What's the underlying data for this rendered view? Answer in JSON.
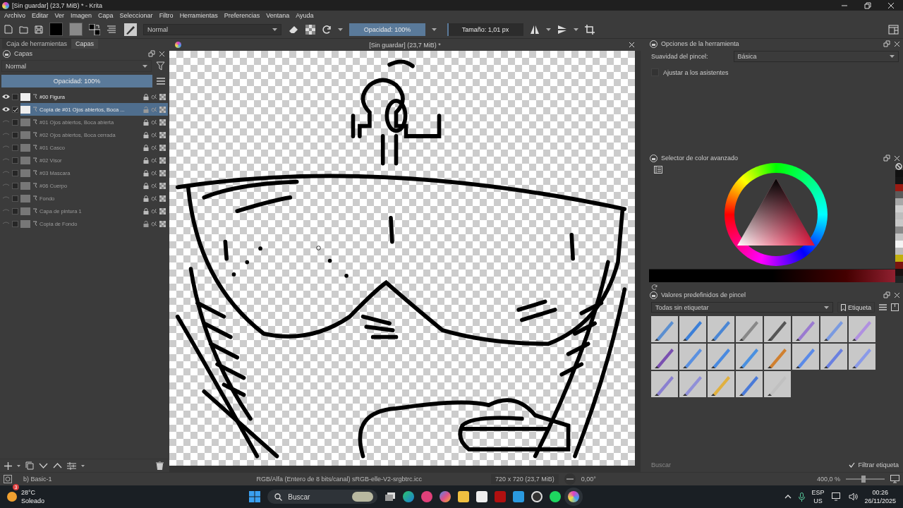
{
  "window": {
    "title": "[Sin guardar]  (23,7 MiB) * - Krita"
  },
  "menu": [
    "Archivo",
    "Editar",
    "Ver",
    "Imagen",
    "Capa",
    "Seleccionar",
    "Filtro",
    "Herramientas",
    "Preferencias",
    "Ventana",
    "Ayuda"
  ],
  "toolbar": {
    "blend_mode": "Normal",
    "opacity": {
      "label": "Opacidad: 100%",
      "level": 1
    },
    "size": {
      "label": "Tamaño: 1,01 px",
      "level": 0.02
    }
  },
  "left_tabs": [
    {
      "label": "Caja de herramientas",
      "selected": false
    },
    {
      "label": "Capas",
      "selected": true
    }
  ],
  "layers_panel": {
    "title": "Capas",
    "blend_mode": "Normal",
    "opacity": {
      "label": "Opacidad:  100%",
      "level": 1
    },
    "layers": [
      {
        "name": "#00 Figura",
        "visible": true,
        "selected": false,
        "active": false,
        "locked": true
      },
      {
        "name": "Copia de #01 Ojos abiertos, Boca ...",
        "visible": true,
        "selected": true,
        "active": true,
        "locked": false
      },
      {
        "name": "#01 Ojos abiertos, Boca abierta",
        "visible": false,
        "selected": false,
        "active": false,
        "locked": true
      },
      {
        "name": "#02 Ojos abiertos, Boca cerrada",
        "visible": false,
        "selected": false,
        "active": false,
        "locked": true
      },
      {
        "name": "#01 Casco",
        "visible": false,
        "selected": false,
        "active": false,
        "locked": true
      },
      {
        "name": "#02 Visor",
        "visible": false,
        "selected": false,
        "active": false,
        "locked": true
      },
      {
        "name": "#03 Mascara",
        "visible": false,
        "selected": false,
        "active": false,
        "locked": true
      },
      {
        "name": "#06 Cuerpo",
        "visible": false,
        "selected": false,
        "active": false,
        "locked": true
      },
      {
        "name": "Fondo",
        "visible": false,
        "selected": false,
        "active": false,
        "locked": true
      },
      {
        "name": "Capa de pintura 1",
        "visible": false,
        "selected": false,
        "active": false,
        "locked": true
      },
      {
        "name": "Copia de Fondo",
        "visible": false,
        "selected": false,
        "active": false,
        "locked": false
      }
    ]
  },
  "document": {
    "title": "[Sin guardar]  (23,7 MiB) *"
  },
  "tool_options": {
    "title": "Opciones de la herramienta",
    "smoothing_label": "Suavidad del pincel:",
    "smoothing_value": "Básica",
    "assistants": {
      "label": "Ajustar a los asistentes",
      "checked": false
    }
  },
  "color_selector": {
    "title": "Selector de color avanzado",
    "recent_colors": [
      {
        "color": "#111111"
      },
      {
        "color": "#151515"
      },
      {
        "color": "#9b1a12"
      },
      {
        "color": "#5a5a5a"
      },
      {
        "color": "#a8a8a8"
      },
      {
        "color": "#cfcfcf"
      },
      {
        "color": "#bdbdbd"
      },
      {
        "color": "#c8c8c8"
      },
      {
        "color": "#8a8a8a"
      },
      {
        "color": "#c4c4c4"
      },
      {
        "color": "#f4f4f4"
      },
      {
        "color": "#bcbcbc"
      },
      {
        "color": "#c2b010"
      },
      {
        "color": "#7a1410"
      },
      {
        "color": "#1a1010"
      },
      {
        "color": "#202424"
      }
    ]
  },
  "brush_presets": {
    "title": "Valores predefinidos de pincel",
    "tag_filter": "Todas sin etiquetar",
    "tag_button": "Etiqueta",
    "search": {
      "placeholder": "Buscar"
    },
    "filter_tag": {
      "label": "Filtrar etiqueta",
      "checked": true
    }
  },
  "status_bar": {
    "brush": "b) Basic-1",
    "color_space": "RGB/Alfa (Entero de 8 bits/canal)  sRGB-elle-V2-srgbtrc.icc",
    "image_size": "720 x 720 (23,7 MiB)",
    "rotation": "0,00°",
    "zoom": {
      "label": "400,0 %",
      "level": 0.45
    }
  },
  "taskbar": {
    "weather": {
      "badge": "3",
      "temperature": "28°C",
      "condition": "Soleado"
    },
    "search": {
      "placeholder": "Buscar"
    },
    "language": "ESP",
    "layout": "US",
    "time": "00:26",
    "date": "26/11/2025"
  }
}
